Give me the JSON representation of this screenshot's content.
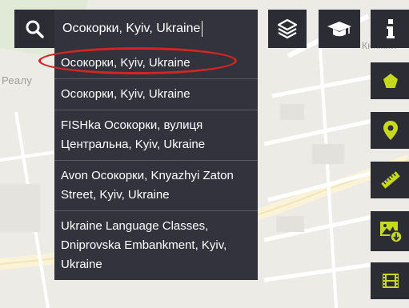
{
  "search": {
    "value": "Осокорки, Kyiv, Ukraine"
  },
  "suggestions": [
    "Осокорки, Kyiv, Ukraine",
    "Осокорки, Kyiv, Ukraine",
    "FISHka Осокорки, вулиця Центральна, Kyiv, Ukraine",
    "Avon Осокорки, Knyazhyi Zaton Street, Kyiv, Ukraine",
    "Ukraine Language Classes, Dniprovska Embankment, Kyiv, Ukraine"
  ],
  "map": {
    "label_left": "Реалу",
    "label_right": "Княжий"
  },
  "toolbar": {
    "icons": [
      "search-icon",
      "layers-icon",
      "graduation-cap-icon",
      "info-icon"
    ]
  },
  "side_tools": {
    "icons": [
      "polygon-icon",
      "map-pin-icon",
      "ruler-icon",
      "image-download-icon",
      "film-icon"
    ],
    "accent_color": "#c6d91e"
  },
  "colors": {
    "panel": "#33333d",
    "highlight": "#d42424"
  }
}
